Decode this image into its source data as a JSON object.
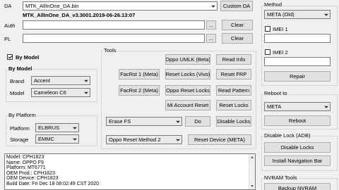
{
  "top": {
    "da_label": "DA",
    "da_value": "MTK_AllInOne_DA.bin",
    "da_path": "MTK_AllInOne_DA_v3.3001.2019-06-26.13:07",
    "custom_da_label": "Custom DA",
    "auth_label": "Auth",
    "auth_value": "",
    "pl_label": "PL",
    "pl_value": "",
    "browse_label": "...",
    "clear_label": "Clear"
  },
  "by_model": {
    "checkbox_label": "By Model",
    "group_title": "By Model",
    "brand_label": "Brand",
    "brand_value": "Accent",
    "model_label": "Model",
    "model_value": "Cameleon C6"
  },
  "by_platform": {
    "group_title": "By Platform",
    "platform_label": "Platform",
    "platform_value": "ELBRUS",
    "storage_label": "Storage",
    "storage_value": "EMMC"
  },
  "tools": {
    "group_title": "Tools",
    "oppo_umlk": "Oppo UMLK (Beta)",
    "read_info": "Read Info",
    "facrst1": "FacRst 1 (Meta)",
    "reset_locks_vivo": "Reset Locks (Vivo)",
    "reset_frp": "Reset FRP",
    "facrst2": "FacRst 2 (Meta)",
    "oppo_reset_locks": "Oppo Reset Locks",
    "read_pattern": "Read Pattern",
    "mi_account_reset": "Mi Account Reset",
    "reset_locks": "Reset Locks",
    "erase_value": "Erase FS",
    "do_label": "Do",
    "disable_locks": "Disable Locks",
    "oppo_method_value": "Oppo Reset Method 2",
    "reset_device_meta": "Reset Device (META)"
  },
  "right": {
    "method_title": "Method",
    "method_value": "META (Old)",
    "imei1_label": "IMEI 1",
    "imei2_label": "IMEI 2",
    "repair_label": "Repair",
    "reboot_title": "Reboot to",
    "reboot_value": "META",
    "reboot_label": "Reboot",
    "disable_lock_title": "Disable Lock (ADB)",
    "disable_locks_label": "Disable Locks",
    "install_nav_label": "Install Navigation Bar",
    "nvram_title": "NVRAM Tools",
    "backup_nvram_label": "Backup NVRAM"
  },
  "log": {
    "lines": [
      "Model: CPH1823",
      "Name: OPPO F9",
      "Platform: MT6771",
      "OEM Prod.: CPH1823",
      "OEM Device: CPH1823",
      "Build Date: Fri Dec 18 08:02:49 CST 2020"
    ]
  }
}
